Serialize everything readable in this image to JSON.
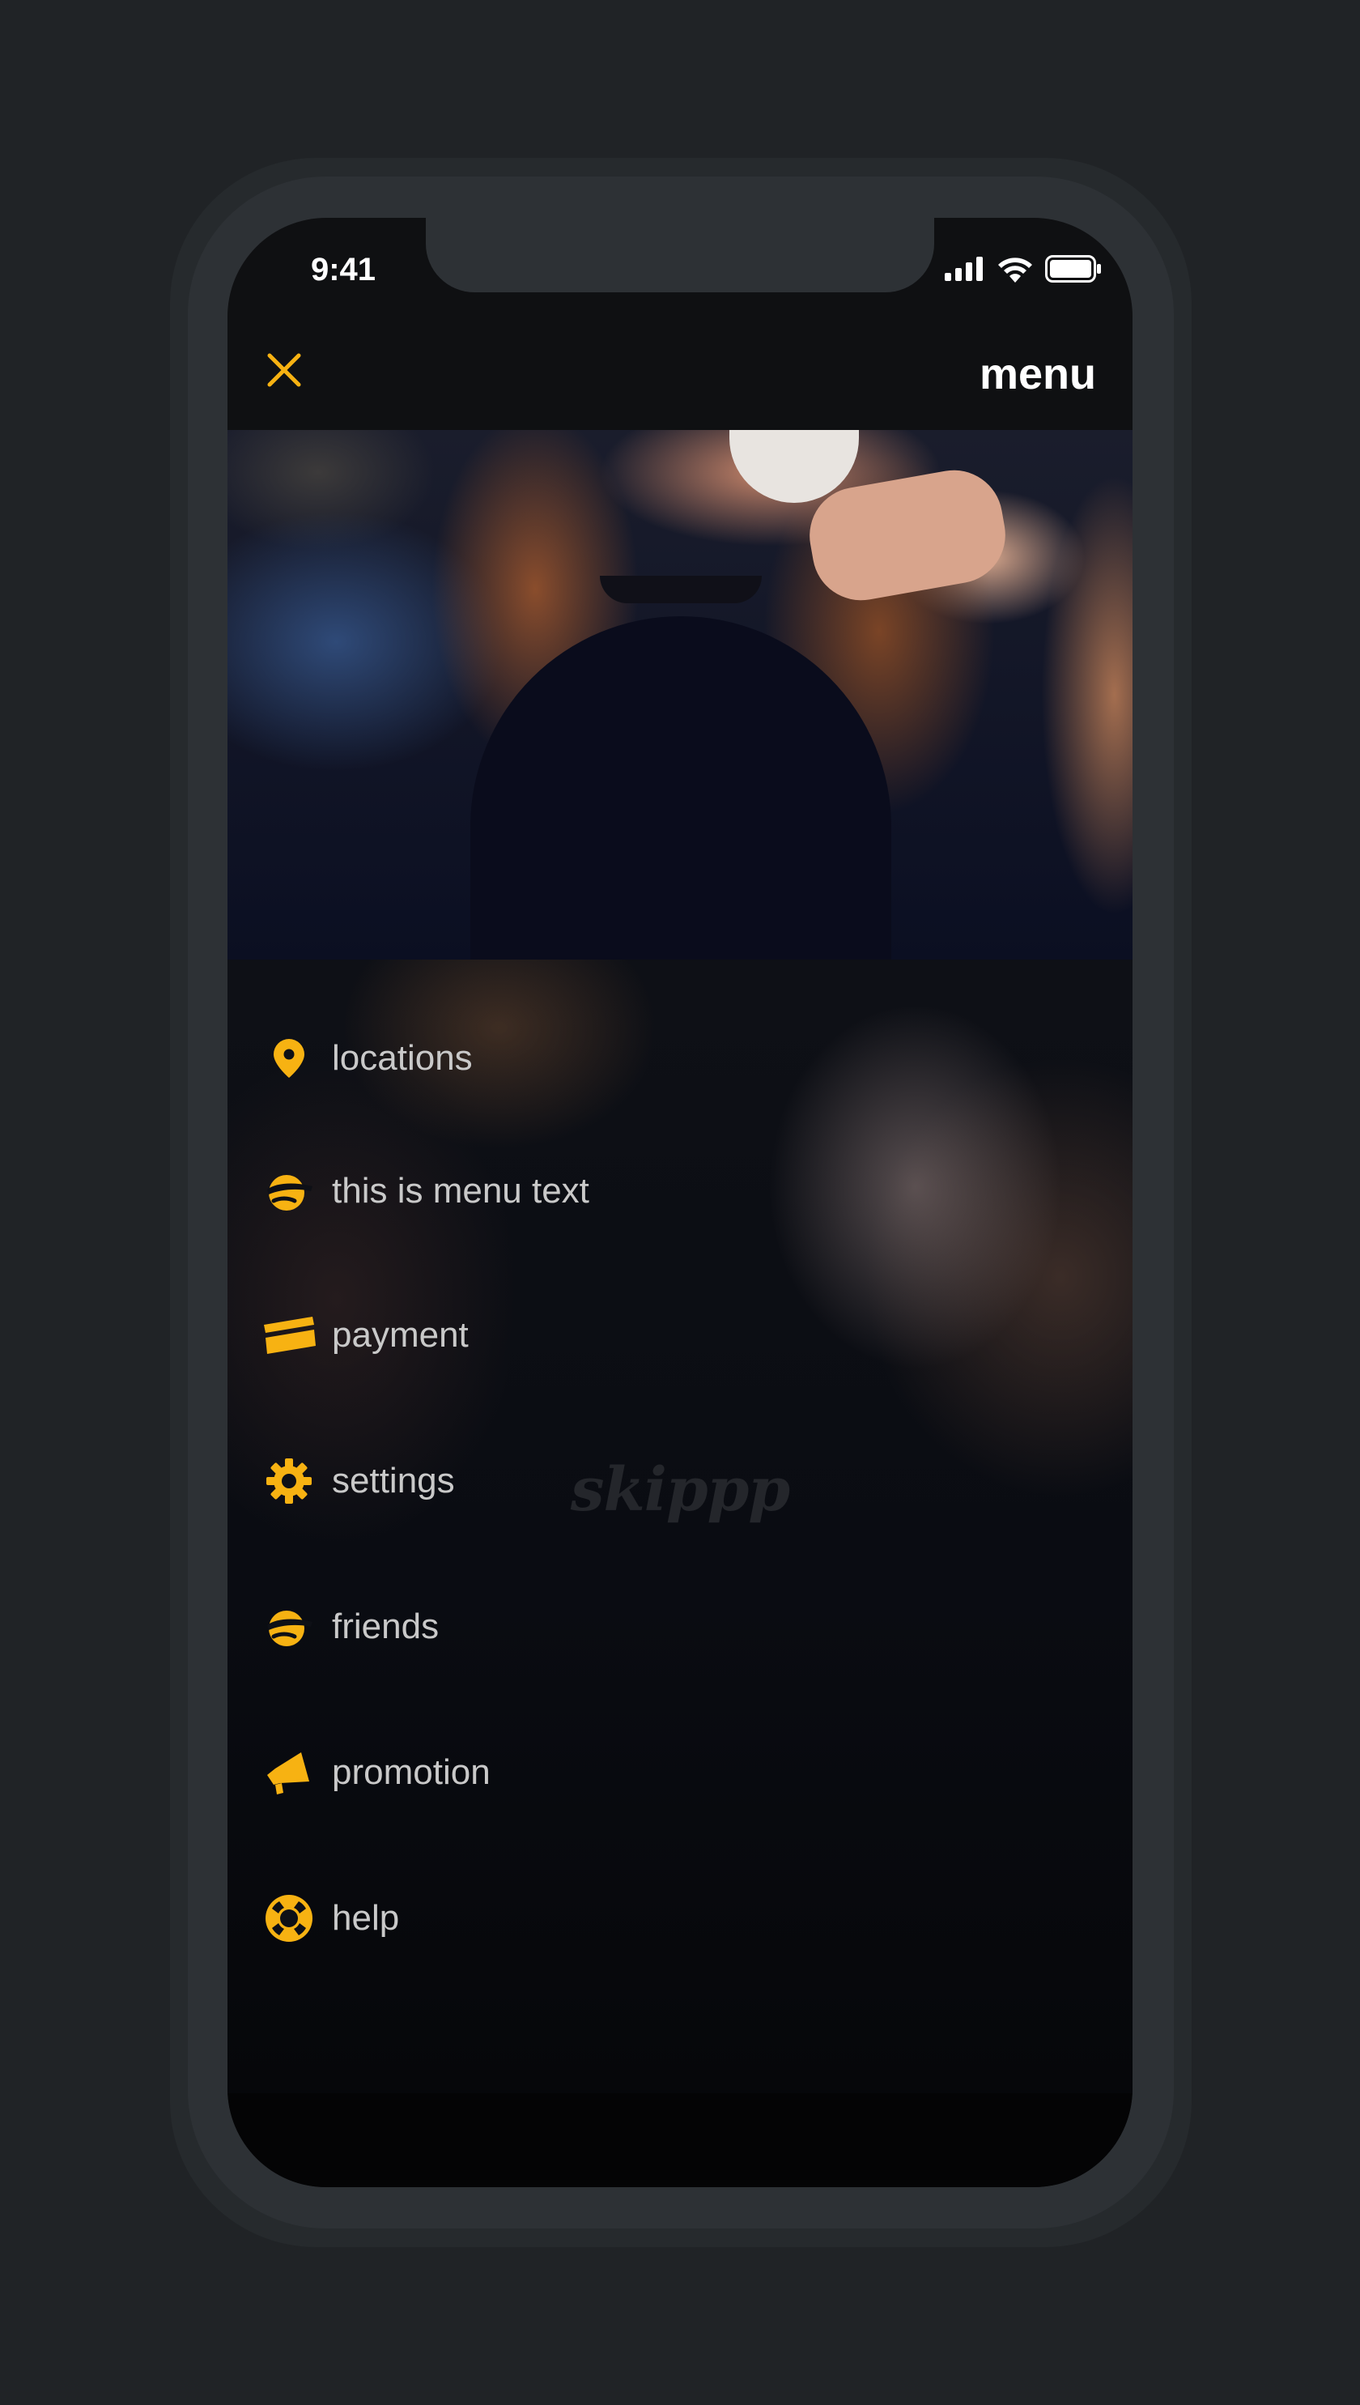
{
  "status_bar": {
    "time": "9:41",
    "icons": [
      "signal-icon",
      "wifi-icon",
      "battery-icon"
    ]
  },
  "header": {
    "close_icon": "close-icon",
    "title": "menu"
  },
  "hero_image": {
    "icon": "photo"
  },
  "menu": {
    "items": [
      {
        "label": "locations",
        "icon": "location-pin-icon"
      },
      {
        "label": "this is menu text",
        "icon": "cap-face-icon"
      },
      {
        "label": "payment",
        "icon": "credit-card-icon"
      },
      {
        "label": "settings",
        "icon": "gear-icon"
      },
      {
        "label": "friends",
        "icon": "cap-face-icon"
      },
      {
        "label": "promotion",
        "icon": "megaphone-icon"
      },
      {
        "label": "help",
        "icon": "lifebuoy-icon"
      }
    ]
  },
  "brand": {
    "logo_text": "skippp"
  },
  "colors": {
    "accent": "#F7B212",
    "background": "#202326",
    "screen": "#0F1012",
    "menu_text": "#C9C9C9",
    "title_text": "#FFFFFF"
  }
}
